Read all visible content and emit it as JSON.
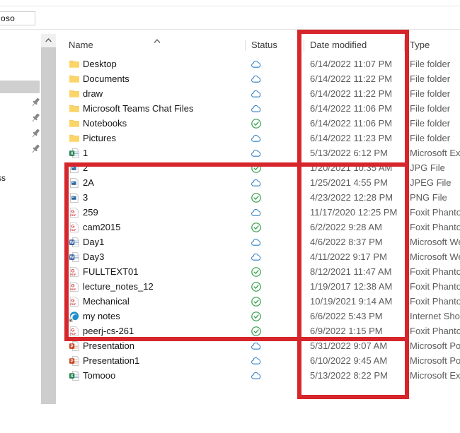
{
  "window": {
    "address_value": "oso"
  },
  "nav": {
    "pinned_label": "",
    "quick_access_label": "ss",
    "pin_icon": "pin-icon"
  },
  "scrollbar": {
    "up_arrow_icon": "chevron-up-icon"
  },
  "columns": {
    "name": "Name",
    "status": "Status",
    "date_modified": "Date modified",
    "type": "Type",
    "sort_indicator_icon": "sort-ascending-icon"
  },
  "status_icons": {
    "cloud": "cloud-icon",
    "available": "green-check-circle-icon"
  },
  "colors": {
    "annotation_red": "#d7262b",
    "folder_yellow": "#fcd568",
    "cloud_blue": "#2d7dc4",
    "check_green": "#2f9e44",
    "excel_green": "#21814c",
    "word_blue": "#2b5797",
    "pdf_red": "#d13438",
    "ppt_orange": "#c4451d",
    "image_blue": "#3a78b5",
    "edge_blue": "#1f8ec9"
  },
  "files": [
    {
      "name": "Desktop",
      "icon": "folder-icon",
      "status": "cloud",
      "date": "6/14/2022 11:07 PM",
      "type": "File folder"
    },
    {
      "name": "Documents",
      "icon": "folder-icon",
      "status": "cloud",
      "date": "6/14/2022 11:22 PM",
      "type": "File folder"
    },
    {
      "name": "draw",
      "icon": "folder-icon",
      "status": "cloud",
      "date": "6/14/2022 11:22 PM",
      "type": "File folder"
    },
    {
      "name": "Microsoft Teams Chat Files",
      "icon": "folder-icon",
      "status": "cloud",
      "date": "6/14/2022 11:06 PM",
      "type": "File folder"
    },
    {
      "name": "Notebooks",
      "icon": "folder-icon",
      "status": "available",
      "date": "6/14/2022 11:06 PM",
      "type": "File folder"
    },
    {
      "name": "Pictures",
      "icon": "folder-icon",
      "status": "cloud",
      "date": "6/14/2022 11:23 PM",
      "type": "File folder"
    },
    {
      "name": "1",
      "icon": "excel-icon",
      "status": "cloud",
      "date": "5/13/2022 6:12 PM",
      "type": "Microsoft Ex"
    },
    {
      "name": "2",
      "icon": "image-icon",
      "status": "available",
      "date": "1/20/2021 10:35 AM",
      "type": "JPG File"
    },
    {
      "name": "2A",
      "icon": "image-icon",
      "status": "cloud",
      "date": "1/25/2021 4:55 PM",
      "type": "JPEG File"
    },
    {
      "name": "3",
      "icon": "image-icon",
      "status": "available",
      "date": "4/23/2022 12:28 PM",
      "type": "PNG File"
    },
    {
      "name": "259",
      "icon": "pdf-icon",
      "status": "cloud",
      "date": "11/17/2020 12:25 PM",
      "type": "Foxit Phanto"
    },
    {
      "name": "cam2015",
      "icon": "pdf-icon",
      "status": "available",
      "date": "6/2/2022 9:28 AM",
      "type": "Foxit Phanto"
    },
    {
      "name": "Day1",
      "icon": "word-icon",
      "status": "cloud",
      "date": "4/6/2022 8:37 PM",
      "type": "Microsoft We"
    },
    {
      "name": "Day3",
      "icon": "word-icon",
      "status": "cloud",
      "date": "4/11/2022 9:17 PM",
      "type": "Microsoft We"
    },
    {
      "name": "FULLTEXT01",
      "icon": "pdf-icon",
      "status": "available",
      "date": "8/12/2021 11:47 AM",
      "type": "Foxit Phanto"
    },
    {
      "name": "lecture_notes_12",
      "icon": "pdf-icon",
      "status": "available",
      "date": "1/19/2017 12:38 AM",
      "type": "Foxit Phanto"
    },
    {
      "name": "Mechanical",
      "icon": "pdf-icon",
      "status": "available",
      "date": "10/19/2021 9:14 AM",
      "type": "Foxit Phanto"
    },
    {
      "name": "my notes",
      "icon": "edge-icon",
      "status": "available",
      "date": "6/6/2022 5:43 PM",
      "type": "Internet Shor"
    },
    {
      "name": "peerj-cs-261",
      "icon": "pdf-icon",
      "status": "available",
      "date": "6/9/2022 1:15 PM",
      "type": "Foxit Phanto"
    },
    {
      "name": "Presentation",
      "icon": "powerpoint-icon",
      "status": "cloud",
      "date": "5/31/2022 9:07 AM",
      "type": "Microsoft Po"
    },
    {
      "name": "Presentation1",
      "icon": "powerpoint-icon",
      "status": "cloud",
      "date": "6/10/2022 9:45 AM",
      "type": "Microsoft Po"
    },
    {
      "name": "Tomooo",
      "icon": "excel-icon",
      "status": "cloud",
      "date": "5/13/2022 8:22 PM",
      "type": "Microsoft Ex"
    }
  ],
  "annotations": [
    {
      "name": "date-modified-column-highlight",
      "target": "Date modified column"
    },
    {
      "name": "file-rows-highlight",
      "target": "rows 2 through peerj-cs-261"
    }
  ]
}
